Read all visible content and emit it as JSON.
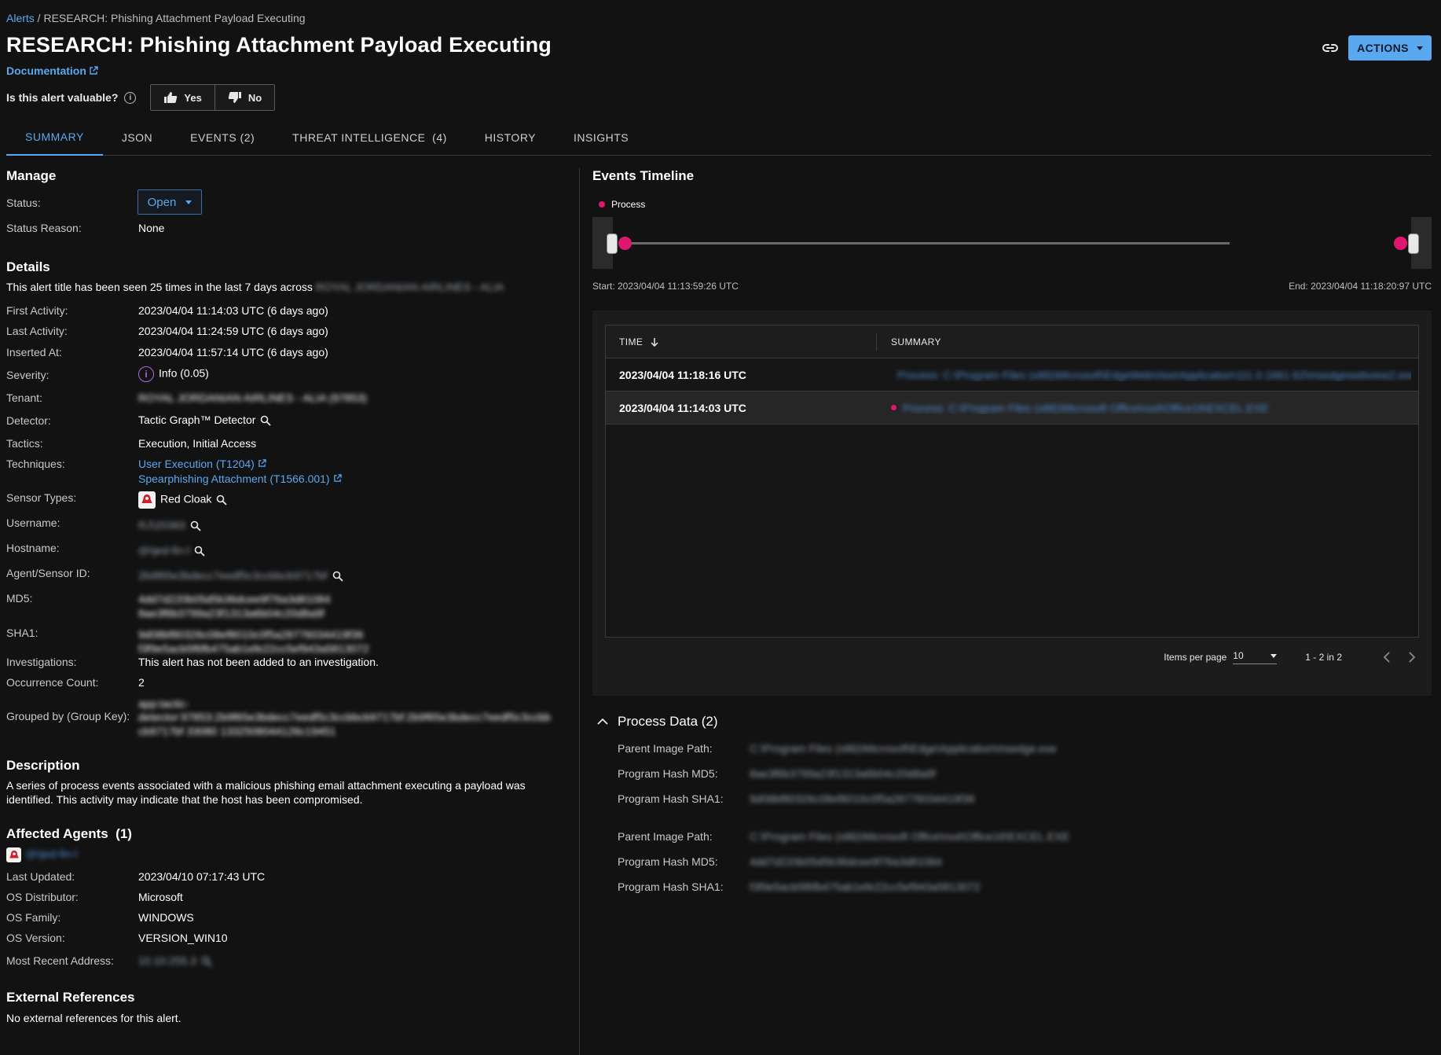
{
  "breadcrumb": {
    "parent": "Alerts",
    "separator": " / ",
    "current": "RESEARCH: Phishing Attachment Payload Executing"
  },
  "title": "RESEARCH: Phishing Attachment Payload Executing",
  "documentation_label": "Documentation",
  "valuable": {
    "question": "Is this alert valuable?",
    "yes": "Yes",
    "no": "No"
  },
  "actions_label": "ACTIONS",
  "tabs": [
    "SUMMARY",
    "JSON",
    "EVENTS (2)",
    "THREAT INTELLIGENCE  (4)",
    "HISTORY",
    "INSIGHTS"
  ],
  "manage": {
    "heading": "Manage",
    "status_label": "Status:",
    "status_value": "Open",
    "reason_label": "Status Reason:",
    "reason_value": "None"
  },
  "details": {
    "heading": "Details",
    "seen_text": "This alert title has been seen 25 times in the last 7 days across",
    "seen_tenant_redacted": "ROYAL JORDANIAN AIRLINES - ALIA",
    "first_activity_label": "First Activity:",
    "first_activity": "2023/04/04 11:14:03 UTC (6 days ago)",
    "last_activity_label": "Last Activity:",
    "last_activity": "2023/04/04 11:24:59 UTC (6 days ago)",
    "inserted_label": "Inserted At:",
    "inserted": "2023/04/04 11:57:14 UTC (6 days ago)",
    "severity_label": "Severity:",
    "severity": "Info (0.05)",
    "tenant_label": "Tenant:",
    "tenant_redacted": "ROYAL JORDANIAN AIRLINES - ALIA (97853)",
    "detector_label": "Detector:",
    "detector": "Tactic Graph™ Detector",
    "tactics_label": "Tactics:",
    "tactics": "Execution, Initial Access",
    "techniques_label": "Techniques:",
    "technique_1": "User Execution (T1204)",
    "technique_2": "Spearphishing Attachment (T1566.001)",
    "sensor_label": "Sensor Types:",
    "sensor": "Red Cloak",
    "username_label": "Username:",
    "username_redacted": "RJ\\20383",
    "hostname_label": "Hostname:",
    "hostname_redacted": "rjh\\jed-fin-l",
    "agent_label": "Agent/Sensor ID:",
    "agent_redacted": "2b9f65e3bdecc7eedf5c3ccbbcb9717bf",
    "md5_label": "MD5:",
    "md5_redacted_1": "4dd7d220b05d5b36dcee9f76a3d81084",
    "md5_redacted_2": "8ae3f6b3799a23f1313a6b04c20d8a9f",
    "sha1_label": "SHA1:",
    "sha1_redacted_1": "9d08bf80326c08ef8010c0f5a28776034419f36",
    "sha1_redacted_2": "f3f9e5acb5f6fb475ab1efe22cc5ef943a5813072",
    "investigations_label": "Investigations:",
    "investigations": "This alert has not been added to an investigation.",
    "occurrence_label": "Occurrence Count:",
    "occurrence": "2",
    "groupkey_label": "Grouped by (Group Key):",
    "groupkey_redacted_1": "app:tactic-",
    "groupkey_redacted_2": "detector:97853:2b9f65e3bdecc7eedf5c3ccbbcb9717bf:2b9f65e3bdecc7eedf5c3ccbb",
    "groupkey_redacted_3": "cb9717bf 33080 1332508044126c19451"
  },
  "description": {
    "heading": "Description",
    "text": "A series of process events associated with a malicious phishing email attachment executing a payload was identified. This activity may indicate that the host has been compromised."
  },
  "agents": {
    "heading": "Affected Agents  (1)",
    "agent_redacted": "rjh\\jed-fin-l",
    "last_updated_label": "Last Updated:",
    "last_updated": "2023/04/10 07:17:43 UTC",
    "os_distributor_label": "OS Distributor:",
    "os_distributor": "Microsoft",
    "os_family_label": "OS Family:",
    "os_family": "WINDOWS",
    "os_version_label": "OS Version:",
    "os_version": "VERSION_WIN10",
    "address_label": "Most Recent Address:",
    "address_redacted": "10.10.255.3"
  },
  "external": {
    "heading": "External References",
    "text": "No external references for this alert."
  },
  "timeline": {
    "heading": "Events Timeline",
    "legend": "Process",
    "start": "Start: 2023/04/04 11:13:59:26 UTC",
    "end": "End: 2023/04/04 11:18:20:97 UTC",
    "columns": [
      "TIME",
      "SUMMARY"
    ],
    "rows": [
      {
        "time": "2023/04/04 11:18:16 UTC",
        "summary_redacted": "Process: C:\\Program Files (x86)\\Microsoft\\EdgeWebView\\Application\\111.0.1661.62\\msedgewebview2.exe"
      },
      {
        "time": "2023/04/04 11:14:03 UTC",
        "summary_redacted": "Process: C:\\Program Files (x86)\\Microsoft Office\\root\\Office16\\EXCEL.EXE"
      }
    ],
    "items_per_page_label": "Items per page",
    "items_per_page": "10",
    "range": "1 - 2 in 2"
  },
  "process_data": {
    "heading": "Process Data (2)",
    "labels": {
      "parent": "Parent Image Path:",
      "md5": "Program Hash MD5:",
      "sha1": "Program Hash SHA1:"
    },
    "entries": [
      {
        "parent_redacted": "C:\\Program Files (x86)\\Microsoft\\Edge\\Application\\msedge.exe",
        "md5_redacted": "8ae3f6b3799a23f1313a6b04c20d8a9f",
        "sha1_redacted": "9d08bf80326c08ef8010c0f5a28776034419f36"
      },
      {
        "parent_redacted": "C:\\Program Files (x86)\\Microsoft Office\\root\\Office16\\EXCEL.EXE",
        "md5_redacted": "4dd7d220b05d5b36dcee9f76a3d81084",
        "sha1_redacted": "f3f9e5acb5f6fb475ab1efe22cc5ef943a5813072"
      }
    ]
  },
  "colors": {
    "accent": "#5aa8f0",
    "process": "#e0176f",
    "severity_info": "#b06ad8",
    "background": "#121212"
  }
}
